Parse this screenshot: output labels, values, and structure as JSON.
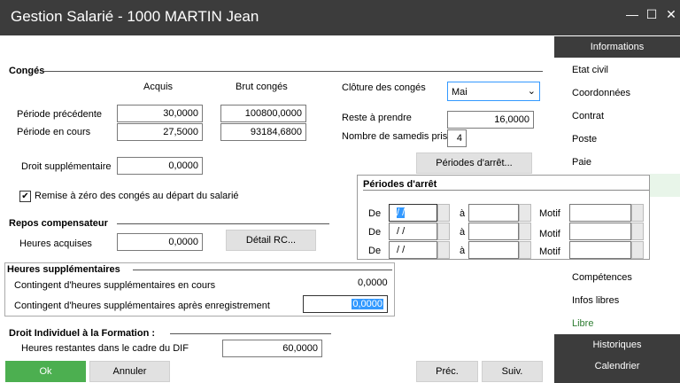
{
  "window": {
    "title": "Gestion Salarié - 1000 MARTIN Jean",
    "min": "—",
    "max": "☐",
    "close": "✕"
  },
  "conges": {
    "section": "Congés",
    "col_acquis": "Acquis",
    "col_brut": "Brut congés",
    "row1_label": "Période précédente",
    "row1_acquis": "30,0000",
    "row1_brut": "100800,0000",
    "row2_label": "Période en cours",
    "row2_acquis": "27,5000",
    "row2_brut": "93184,6800",
    "droit_label": "Droit supplémentaire",
    "droit_value": "0,0000",
    "remise_label": "Remise à zéro des congés au départ du salarié",
    "remise_checked": "✔",
    "cloture_label": "Clôture des congés",
    "cloture_value": "Mai",
    "reste_label": "Reste à prendre",
    "reste_value": "16,0000",
    "samedis_label": "Nombre de samedis pris",
    "samedis_value": "4",
    "periodes_button": "Périodes d'arrêt..."
  },
  "repos": {
    "section": "Repos compensateur",
    "heures_label": "Heures acquises",
    "heures_value": "0,0000",
    "detail_button": "Détail RC..."
  },
  "heures_sup": {
    "section": "Heures supplémentaires",
    "row1_label": "Contingent d'heures supplémentaires en cours",
    "row1_value": "0,0000",
    "row2_label": "Contingent d'heures supplémentaires après enregistrement",
    "row2_value": "0,0000"
  },
  "dif": {
    "section": "Droit Individuel à la Formation :",
    "label": "Heures restantes dans le cadre du DIF",
    "value": "60,0000"
  },
  "periodes_popup": {
    "title": "Périodes d'arrêt",
    "de": "De",
    "a": "à",
    "motif": "Motif",
    "date": " /  /"
  },
  "footer": {
    "ok": "Ok",
    "annuler": "Annuler",
    "prec": "Préc.",
    "suiv": "Suiv."
  },
  "sidebar": {
    "informations": "Informations",
    "items": [
      "Etat civil",
      "Coordonnées",
      "Contrat",
      "Poste",
      "Paie"
    ],
    "items_bottom": [
      "Compétences",
      "Infos libres",
      "Libre"
    ],
    "historiques": "Historiques",
    "calendrier": "Calendrier"
  },
  "colors": {
    "dark": "#3c3c3c",
    "green": "#4caf50",
    "highlight": "#3399ff",
    "sel_bg": "#e8f5e9"
  }
}
